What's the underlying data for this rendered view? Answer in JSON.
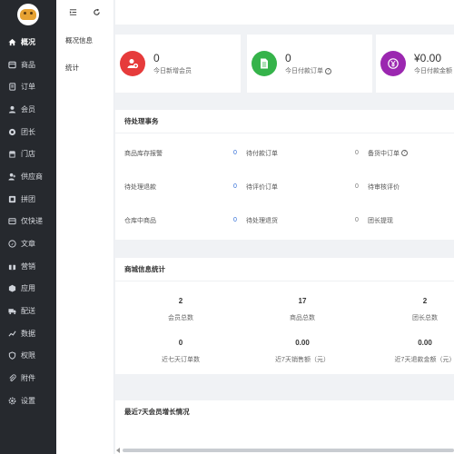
{
  "sidebar": {
    "items": [
      {
        "label": "概况",
        "icon": "home-icon",
        "active": true
      },
      {
        "label": "商品",
        "icon": "goods-icon"
      },
      {
        "label": "订单",
        "icon": "order-icon"
      },
      {
        "label": "会员",
        "icon": "member-icon"
      },
      {
        "label": "团长",
        "icon": "leader-icon"
      },
      {
        "label": "门店",
        "icon": "store-icon"
      },
      {
        "label": "供应商",
        "icon": "supplier-icon"
      },
      {
        "label": "拼团",
        "icon": "groupbuy-icon"
      },
      {
        "label": "仅快递",
        "icon": "express-icon"
      },
      {
        "label": "文章",
        "icon": "article-icon"
      },
      {
        "label": "营销",
        "icon": "marketing-icon"
      },
      {
        "label": "应用",
        "icon": "app-icon"
      },
      {
        "label": "配送",
        "icon": "delivery-icon"
      },
      {
        "label": "数据",
        "icon": "data-icon"
      },
      {
        "label": "权限",
        "icon": "permission-icon"
      },
      {
        "label": "附件",
        "icon": "attachment-icon"
      },
      {
        "label": "设置",
        "icon": "settings-icon"
      }
    ]
  },
  "subnav": {
    "items": [
      "概况信息",
      "统计"
    ]
  },
  "cards": [
    {
      "value": "0",
      "label": "今日新增会员",
      "color": "#e63b3b",
      "icon": "add-user-icon",
      "help": false
    },
    {
      "value": "0",
      "label": "今日付款订单",
      "color": "#35b34a",
      "icon": "document-icon",
      "help": true
    },
    {
      "value": "¥0.00",
      "label": "今日付款金额",
      "color": "#9b27b0",
      "icon": "yen-icon",
      "help": false
    }
  ],
  "pending": {
    "title": "待处理事务",
    "rows": [
      [
        {
          "label": "商品库存报警",
          "count": "0",
          "count_color": "blue"
        },
        {
          "label": "待付款订单",
          "count": "0",
          "count_color": "gray"
        },
        {
          "label": "备货中订单",
          "count": "",
          "help": true
        }
      ],
      [
        {
          "label": "待处理退款",
          "count": "0",
          "count_color": "blue"
        },
        {
          "label": "待评价订单",
          "count": "0",
          "count_color": "gray"
        },
        {
          "label": "待审核评价",
          "count": ""
        }
      ],
      [
        {
          "label": "仓库中商品",
          "count": "0",
          "count_color": "blue"
        },
        {
          "label": "待处理退货",
          "count": "0",
          "count_color": "gray"
        },
        {
          "label": "团长提现",
          "count": ""
        }
      ]
    ]
  },
  "mall_stats": {
    "title": "商城信息统计",
    "items": [
      {
        "value": "2",
        "label": "会员总数"
      },
      {
        "value": "17",
        "label": "商品总数"
      },
      {
        "value": "2",
        "label": "团长总数"
      },
      {
        "value": "0",
        "label": "近七天订单数"
      },
      {
        "value": "0.00",
        "label": "近7天销售额（元）"
      },
      {
        "value": "0.00",
        "label": "近7天退款金额（元）"
      }
    ]
  },
  "growth": {
    "title": "最近7天会员增长情况"
  }
}
